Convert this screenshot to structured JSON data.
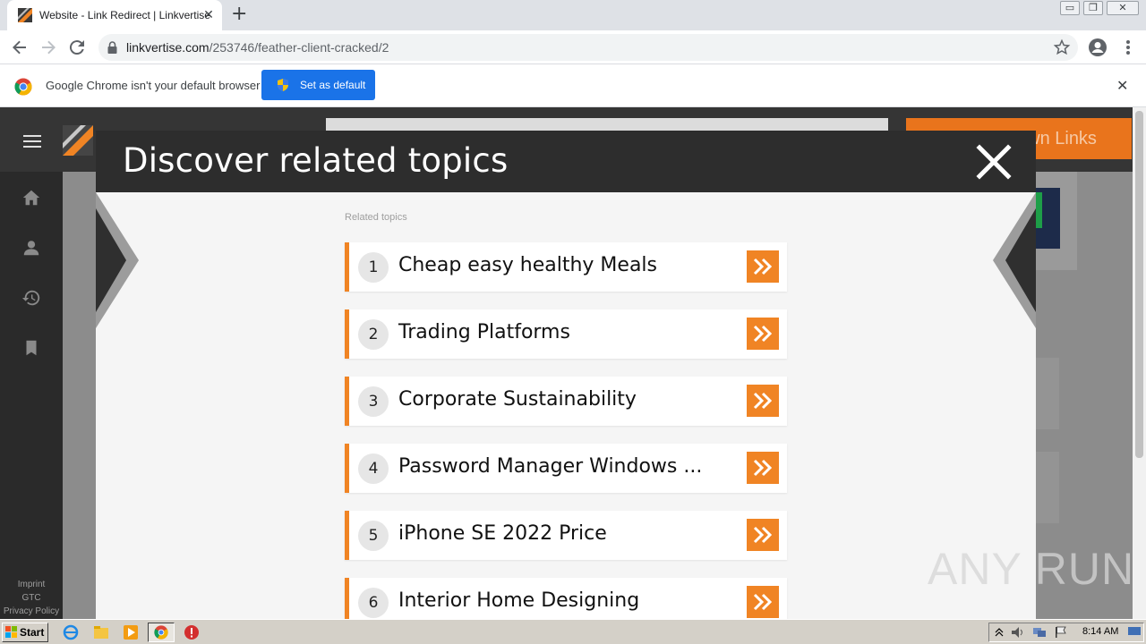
{
  "browser": {
    "tab_title": "Website - Link Redirect | Linkvertise",
    "tab_close": "✕",
    "new_tab": "+",
    "url_domain": "linkvertise.com",
    "url_path": "/253746/feather-client-cracked/2",
    "window_controls": [
      "▭",
      "❐",
      "✕"
    ]
  },
  "infobar": {
    "message": "Google Chrome isn't your default browser",
    "button_label": "Set as default",
    "close": "✕"
  },
  "site": {
    "header_button_partial": "own Links",
    "footer_links": [
      "Imprint",
      "GTC",
      "Privacy Policy"
    ]
  },
  "modal": {
    "title": "Discover related topics",
    "section_label": "Related topics",
    "topics": [
      {
        "num": "1",
        "label": "Cheap easy healthy Meals"
      },
      {
        "num": "2",
        "label": "Trading Platforms"
      },
      {
        "num": "3",
        "label": "Corporate Sustainability"
      },
      {
        "num": "4",
        "label": "Password Manager Windows ..."
      },
      {
        "num": "5",
        "label": "iPhone SE 2022 Price"
      },
      {
        "num": "6",
        "label": "Interior Home Designing"
      }
    ]
  },
  "watermark": "ANY RUN",
  "taskbar": {
    "start_label": "Start",
    "clock": "8:14 AM"
  },
  "colors": {
    "accent_orange": "#f08424",
    "chrome_blue": "#1a73e8",
    "modal_header": "#2d2d2d"
  }
}
